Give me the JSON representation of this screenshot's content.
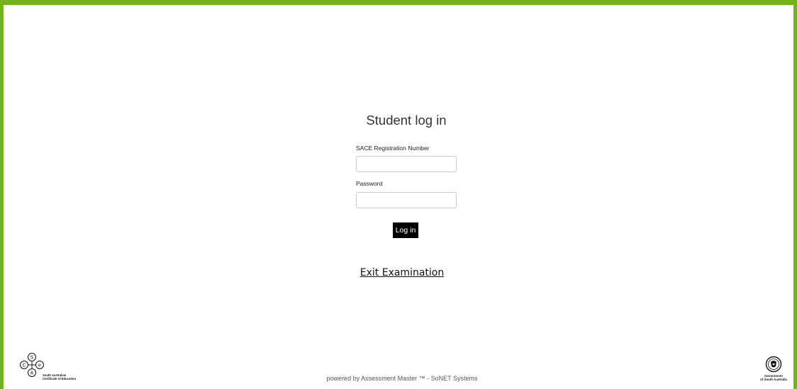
{
  "login": {
    "title": "Student log in",
    "registration_label": "SACE Registration Number",
    "registration_value": "",
    "password_label": "Password",
    "password_value": "",
    "submit_label": "Log in"
  },
  "exit_link": "Exit Examination",
  "footer": {
    "powered_by": "powered by Assessment Master ™ - SoNET Systems"
  },
  "logos": {
    "sace": {
      "letters": [
        "S",
        "C",
        "e",
        "A"
      ],
      "line1": "South Australian",
      "line2": "Certificate of Education"
    },
    "government": {
      "line1": "Government",
      "line2": "of South Australia"
    }
  },
  "colors": {
    "frame": "#74b11c",
    "button": "#000000",
    "button_text": "#ffffff"
  },
  "icons": {
    "sace": "sace-logo-icon",
    "government": "gov-sa-crest-icon"
  }
}
